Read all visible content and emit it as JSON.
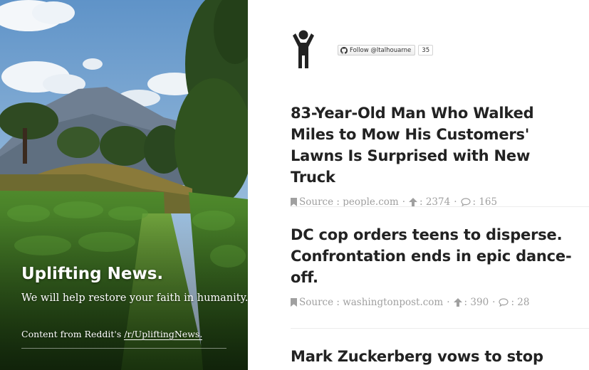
{
  "hero": {
    "title": "Uplifting News.",
    "tagline": "We will help restore your faith in humanity.",
    "credit_prefix": "Content from Reddit's ",
    "credit_link": "/r/UpliftingNews."
  },
  "profile": {
    "avatar_icon": "person-arms-up-icon",
    "follow_label": "Follow @ltalhouarne",
    "follow_count": "35",
    "follow_icon": "github-icon"
  },
  "articles": [
    {
      "title": "83-Year-Old Man Who Walked Miles to Mow His Customers' Lawns Is Surprised with New Truck",
      "source": "Source : people.com",
      "upvotes": ": 2374",
      "comments": ": 165"
    },
    {
      "title": "DC cop orders teens to disperse. Confrontation ends in epic dance-off.",
      "source": "Source : washingtonpost.com",
      "upvotes": ": 390",
      "comments": ": 28"
    },
    {
      "title": "Mark Zuckerberg vows to stop"
    }
  ],
  "colors": {
    "title_text": "#222222",
    "meta_text": "#a0a0a0",
    "divider": "#ececec",
    "hero_text": "#ffffff"
  },
  "icons": {
    "source": "bookmark-icon",
    "upvotes": "arrow-up-icon",
    "comments": "speech-bubble-icon"
  }
}
